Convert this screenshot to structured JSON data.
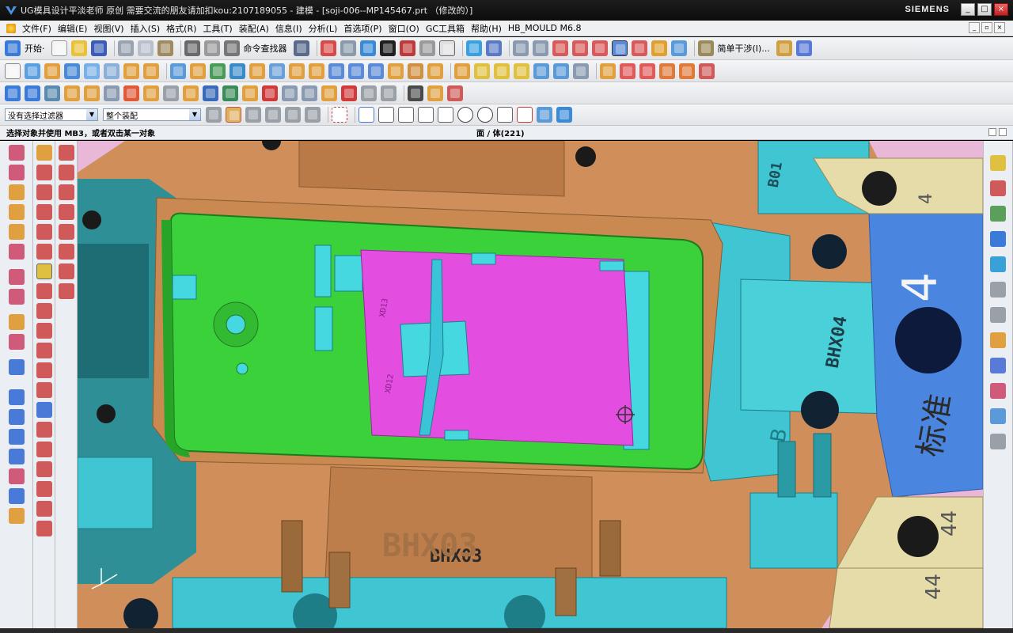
{
  "window": {
    "title": "UG模具设计平淡老师 原创 需要交流的朋友请加扣kou:2107189055 - 建模 - [soji-006--MP145467.prt （修改的）]",
    "brand": "SIEMENS",
    "controls": [
      "_",
      "□",
      "×"
    ]
  },
  "menu": {
    "items": [
      "文件(F)",
      "编辑(E)",
      "视图(V)",
      "插入(S)",
      "格式(R)",
      "工具(T)",
      "装配(A)",
      "信息(I)",
      "分析(L)",
      "首选项(P)",
      "窗口(O)",
      "GC工具箱",
      "帮助(H)",
      "HB_MOULD M6.8"
    ],
    "mdi_controls": [
      "_",
      "▫",
      "×"
    ]
  },
  "toolbar1": {
    "start_label": "开始·",
    "command_finder_label": "命令查找器",
    "simple_interference_label": "简单干涉(I)..."
  },
  "selection_bar": {
    "filter_value": "没有选择过滤器",
    "scope_value": "整个装配"
  },
  "cue_line": {
    "prompt": "选择对象并使用 MB3，或者双击某一对象",
    "status": "面 / 体(221)"
  },
  "model_labels": {
    "b01": "B01",
    "plate4_small": "4",
    "plate4_big": "4",
    "bhx04": "BHX04",
    "biaozhun": "标准",
    "b_mark": "B",
    "bhx03": "BHX03",
    "num44_a": "44",
    "num44_b": "44",
    "xd1": "XD13",
    "xd2": "XD12",
    "cavity_label": "BHX03"
  },
  "colors": {
    "mold_base": "#cf8e5a",
    "core_insert": "#3bd13b",
    "cavity_face": "#e34de0",
    "plate_cyan": "#3fc6d2",
    "plate_blue": "#4a86e0",
    "plate_cream": "#e6dcaa",
    "background_pink": "#e9b7d8"
  },
  "icons": {
    "toolbar": [
      "start-icon",
      "new-file-icon",
      "open-folder-icon",
      "save-icon",
      "cut-icon",
      "copy-icon",
      "paste-icon",
      "undo-icon",
      "redo-icon",
      "command-finder-icon",
      "select-icon",
      "view-fit-icon",
      "shaded-icon",
      "render-icon",
      "interference-icon"
    ],
    "left_palette": [
      "sketch-icon",
      "extrude-icon",
      "revolve-icon",
      "hole-icon",
      "blend-icon",
      "chamfer-icon",
      "shell-icon",
      "trim-icon",
      "mirror-icon",
      "pattern-icon"
    ],
    "right_palette": [
      "assembly-navigator-icon",
      "constraint-navigator-icon",
      "part-navigator-icon",
      "reuse-library-icon",
      "web-browser-icon",
      "history-icon",
      "system-materials-icon",
      "process-studio-icon",
      "roles-icon",
      "system-scene-icon",
      "manufacturing-wizard-icon"
    ]
  }
}
